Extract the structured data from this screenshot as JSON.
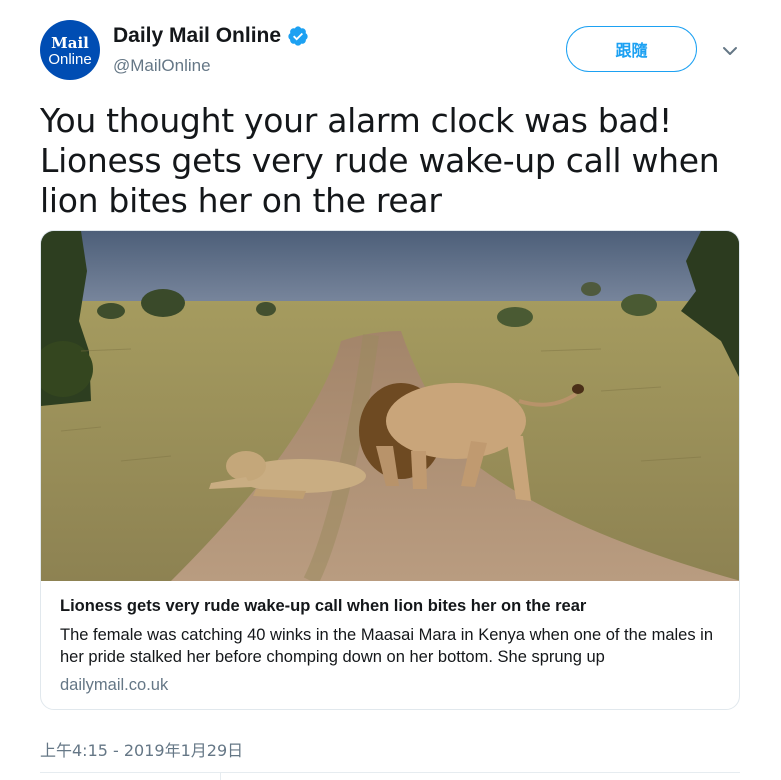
{
  "account": {
    "avatar_line1": "Mail",
    "avatar_line2": "Online",
    "name": "Daily Mail Online",
    "handle": "@MailOnline",
    "verified": true,
    "brand_color": "#004db3"
  },
  "follow_button": {
    "label": "跟隨"
  },
  "menu": {
    "icon": "chevron-down-icon"
  },
  "tweet": {
    "text": "You thought your alarm clock was bad! Lioness gets very rude wake-up call when lion bites her on the rear"
  },
  "card": {
    "image_alt": "lion-biting-lioness-on-dirt-road-photo",
    "title": "Lioness gets very rude wake-up call when lion bites her on the rear",
    "description": "The female was catching 40 winks in the Maasai Mara in Kenya when one of the males in her pride stalked her before chomping down on her bottom. She sprung up",
    "domain": "dailymail.co.uk"
  },
  "timestamp": "上午4:15 - 2019年1月29日",
  "colors": {
    "accent": "#1da1f2",
    "secondary_text": "#657786",
    "border": "#e1e8ed"
  }
}
